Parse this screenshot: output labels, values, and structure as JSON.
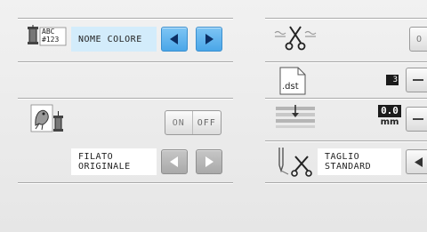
{
  "thread": {
    "icon_code_line1": "ABC",
    "icon_code_line2": "#123",
    "label": "NOME COLORE"
  },
  "original_thread": {
    "toggle_on": "ON",
    "toggle_off": "OFF",
    "label_line1": "FILATO",
    "label_line2": "ORIGINALE"
  },
  "right": {
    "cut_button_partial": "O",
    "file_ext": ".dst",
    "value_digit": "3",
    "mm_value": "0.0",
    "mm_unit": "mm",
    "trim_label_line1": "TAGLIO",
    "trim_label_line2": "STANDARD"
  },
  "colors": {
    "accent_blue": "#4aa6e8",
    "label_bg": "#d3ecfb",
    "panel_bg": "#ececec"
  }
}
